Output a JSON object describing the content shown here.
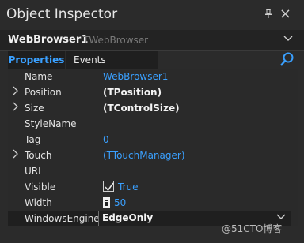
{
  "window": {
    "title": "Object Inspector",
    "pin_icon": "pin-icon",
    "close_icon": "close-icon"
  },
  "component": {
    "name": "WebBrowser1",
    "type": "TWebBrowser"
  },
  "tabs": [
    {
      "label": "Properties"
    },
    {
      "label": "Events"
    }
  ],
  "properties": [
    {
      "name": "Name",
      "value": "WebBrowser1"
    },
    {
      "name": "Position",
      "value": "(TPosition)"
    },
    {
      "name": "Size",
      "value": "(TControlSize)"
    },
    {
      "name": "StyleName",
      "value": ""
    },
    {
      "name": "Tag",
      "value": "0"
    },
    {
      "name": "Touch",
      "value": "(TTouchManager)"
    },
    {
      "name": "URL",
      "value": ""
    },
    {
      "name": "Visible",
      "value": "True"
    },
    {
      "name": "Width",
      "value": "50"
    },
    {
      "name": "WindowsEngine",
      "value": "EdgeOnly"
    }
  ],
  "watermark": "@51CTO博客",
  "colors": {
    "accent": "#3aa0ff",
    "background": "#2b2b2b",
    "grid": "#2a2a2a"
  }
}
